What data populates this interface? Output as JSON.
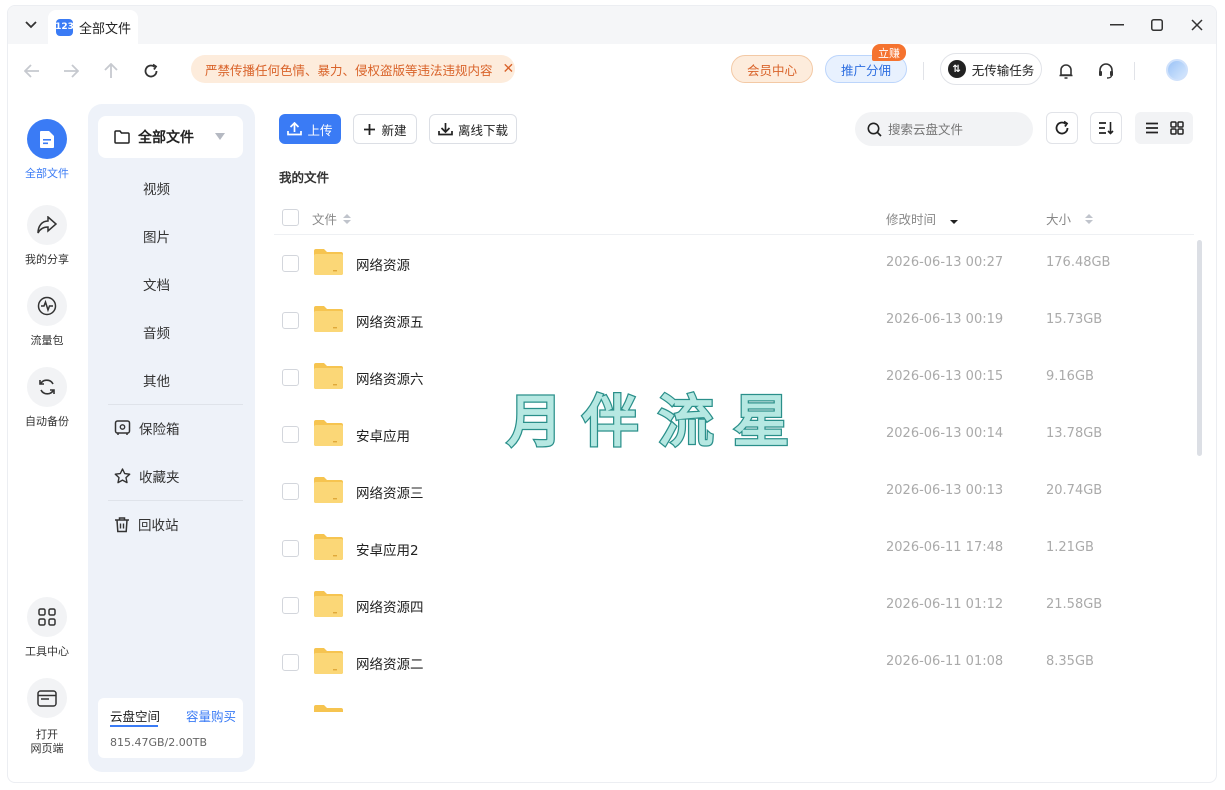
{
  "window": {
    "tab_title": "全部文件",
    "tab_logo": "123"
  },
  "navbar": {
    "notice": "严禁传播任何色情、暴力、侵权盗版等违法违规内容",
    "member_center": "会员中心",
    "promote": "推广分佣",
    "promote_badge": "立赚",
    "transfer": "无传输任务"
  },
  "rail": [
    {
      "label": "全部文件",
      "icon": "file-icon",
      "active": true
    },
    {
      "label": "我的分享",
      "icon": "share-icon"
    },
    {
      "label": "流量包",
      "icon": "traffic-icon"
    },
    {
      "label": "自动备份",
      "icon": "sync-icon"
    },
    {
      "label": "工具中心",
      "icon": "grid-icon"
    },
    {
      "label_line1": "打开",
      "label_line2": "网页端",
      "icon": "browser-icon"
    }
  ],
  "sidebar": {
    "all_files": "全部文件",
    "categories": [
      "视频",
      "图片",
      "文档",
      "音频",
      "其他"
    ],
    "safe_box": "保险箱",
    "favorites": "收藏夹",
    "recycle": "回收站",
    "storage_tab": "云盘空间",
    "buy_capacity": "容量购买",
    "usage": "815.47GB/2.00TB"
  },
  "toolbar": {
    "upload": "上传",
    "new": "新建",
    "offline_download": "离线下载",
    "search_placeholder": "搜索云盘文件"
  },
  "breadcrumb": "我的文件",
  "table": {
    "col_file": "文件",
    "col_modified": "修改时间",
    "col_size": "大小",
    "rows": [
      {
        "name": "网络资源",
        "time": "2026-06-13 00:27",
        "size": "176.48GB"
      },
      {
        "name": "网络资源五",
        "time": "2026-06-13 00:19",
        "size": "15.73GB"
      },
      {
        "name": "网络资源六",
        "time": "2026-06-13 00:15",
        "size": "9.16GB"
      },
      {
        "name": "安卓应用",
        "time": "2026-06-13 00:14",
        "size": "13.78GB"
      },
      {
        "name": "网络资源三",
        "time": "2026-06-13 00:13",
        "size": "20.74GB"
      },
      {
        "name": "安卓应用2",
        "time": "2026-06-11 17:48",
        "size": "1.21GB"
      },
      {
        "name": "网络资源四",
        "time": "2026-06-11 01:12",
        "size": "21.58GB"
      },
      {
        "name": "网络资源二",
        "time": "2026-06-11 01:08",
        "size": "8.35GB"
      }
    ]
  },
  "watermark": "月 伴 流 星",
  "colors": {
    "accent": "#3a7bf5",
    "notice": "#d9632a",
    "folder": "#fbd26b"
  }
}
